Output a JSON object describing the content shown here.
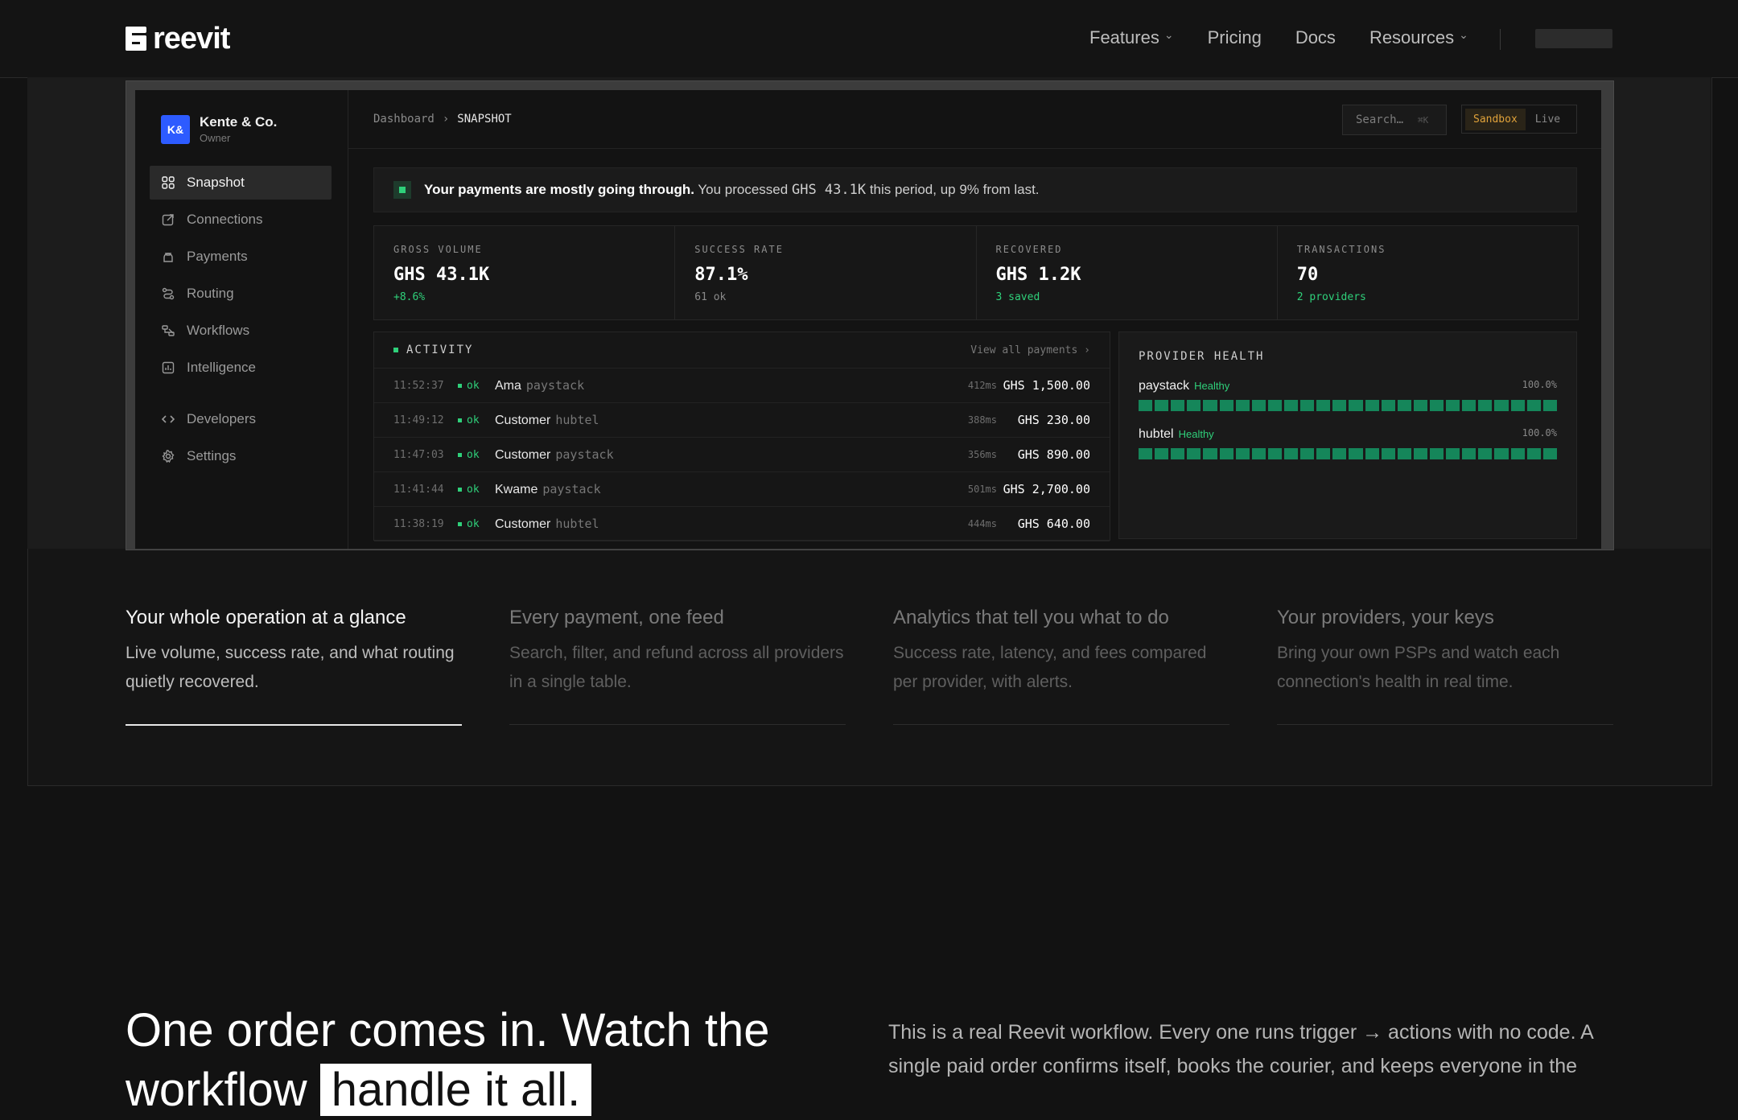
{
  "nav": {
    "logo": "reevit",
    "links": [
      {
        "label": "Features",
        "dropdown": true
      },
      {
        "label": "Pricing",
        "dropdown": false
      },
      {
        "label": "Docs",
        "dropdown": false
      },
      {
        "label": "Resources",
        "dropdown": true
      }
    ]
  },
  "app": {
    "workspace": {
      "initials": "K&",
      "name": "Kente & Co.",
      "role": "Owner"
    },
    "menu": [
      {
        "label": "Snapshot",
        "icon": "grid-icon",
        "active": true
      },
      {
        "label": "Connections",
        "icon": "link-icon"
      },
      {
        "label": "Payments",
        "icon": "bag-icon"
      },
      {
        "label": "Routing",
        "icon": "route-icon"
      },
      {
        "label": "Workflows",
        "icon": "workflow-icon"
      },
      {
        "label": "Intelligence",
        "icon": "chart-icon"
      }
    ],
    "menu_bottom": [
      {
        "label": "Developers",
        "icon": "code-icon"
      },
      {
        "label": "Settings",
        "icon": "gear-icon"
      }
    ],
    "breadcrumb": {
      "root": "Dashboard",
      "current": "SNAPSHOT"
    },
    "search": {
      "placeholder": "Search…",
      "shortcut": "⌘K"
    },
    "env": {
      "sandbox": "Sandbox",
      "live": "Live"
    },
    "banner": {
      "bold": "Your payments are mostly going through.",
      "text_before": "You processed",
      "amount": "GHS 43.1K",
      "text_after": "this period, up 9% from last."
    },
    "stats": [
      {
        "label": "GROSS VOLUME",
        "value": "GHS 43.1K",
        "sub": "+8.6%",
        "green": true
      },
      {
        "label": "SUCCESS RATE",
        "value": "87.1%",
        "sub": "61 ok",
        "green": false
      },
      {
        "label": "RECOVERED",
        "value": "GHS 1.2K",
        "sub": "3 saved",
        "green": true
      },
      {
        "label": "TRANSACTIONS",
        "value": "70",
        "sub": "2 providers",
        "green": true
      }
    ],
    "activity": {
      "title": "ACTIVITY",
      "view_all": "View all payments ›",
      "rows": [
        {
          "time": "11:52:37",
          "status": "ok",
          "name": "Ama",
          "provider": "paystack",
          "latency": "412ms",
          "amount": "GHS 1,500.00"
        },
        {
          "time": "11:49:12",
          "status": "ok",
          "name": "Customer",
          "provider": "hubtel",
          "latency": "388ms",
          "amount": "GHS 230.00"
        },
        {
          "time": "11:47:03",
          "status": "ok",
          "name": "Customer",
          "provider": "paystack",
          "latency": "356ms",
          "amount": "GHS 890.00"
        },
        {
          "time": "11:41:44",
          "status": "ok",
          "name": "Kwame",
          "provider": "paystack",
          "latency": "501ms",
          "amount": "GHS 2,700.00"
        },
        {
          "time": "11:38:19",
          "status": "ok",
          "name": "Customer",
          "provider": "hubtel",
          "latency": "444ms",
          "amount": "GHS 640.00"
        }
      ]
    },
    "health": {
      "title": "PROVIDER HEALTH",
      "providers": [
        {
          "name": "paystack",
          "status": "Healthy",
          "pct": "100.0%",
          "segments": 26
        },
        {
          "name": "hubtel",
          "status": "Healthy",
          "pct": "100.0%",
          "segments": 26
        }
      ]
    }
  },
  "features": [
    {
      "title": "Your whole operation at a glance",
      "desc": "Live volume, success rate, and what routing quietly recovered.",
      "active": true
    },
    {
      "title": "Every payment, one feed",
      "desc": "Search, filter, and refund across all providers in a single table.",
      "active": false
    },
    {
      "title": "Analytics that tell you what to do",
      "desc": "Success rate, latency, and fees compared per provider, with alerts.",
      "active": false
    },
    {
      "title": "Your providers, your keys",
      "desc": "Bring your own PSPs and watch each connection's health in real time.",
      "active": false
    }
  ],
  "workflow": {
    "title_start": "One order comes in. Watch the workflow",
    "title_highlight": "handle it all.",
    "intro": "This is a real Reevit workflow. Every one runs trigger → actions with no code. A single paid order confirms itself, books the courier, and keeps everyone in the"
  },
  "colors": {
    "accent_green": "#2fd07a",
    "sandbox": "#e0a23a",
    "avatar": "#2d5bff"
  }
}
